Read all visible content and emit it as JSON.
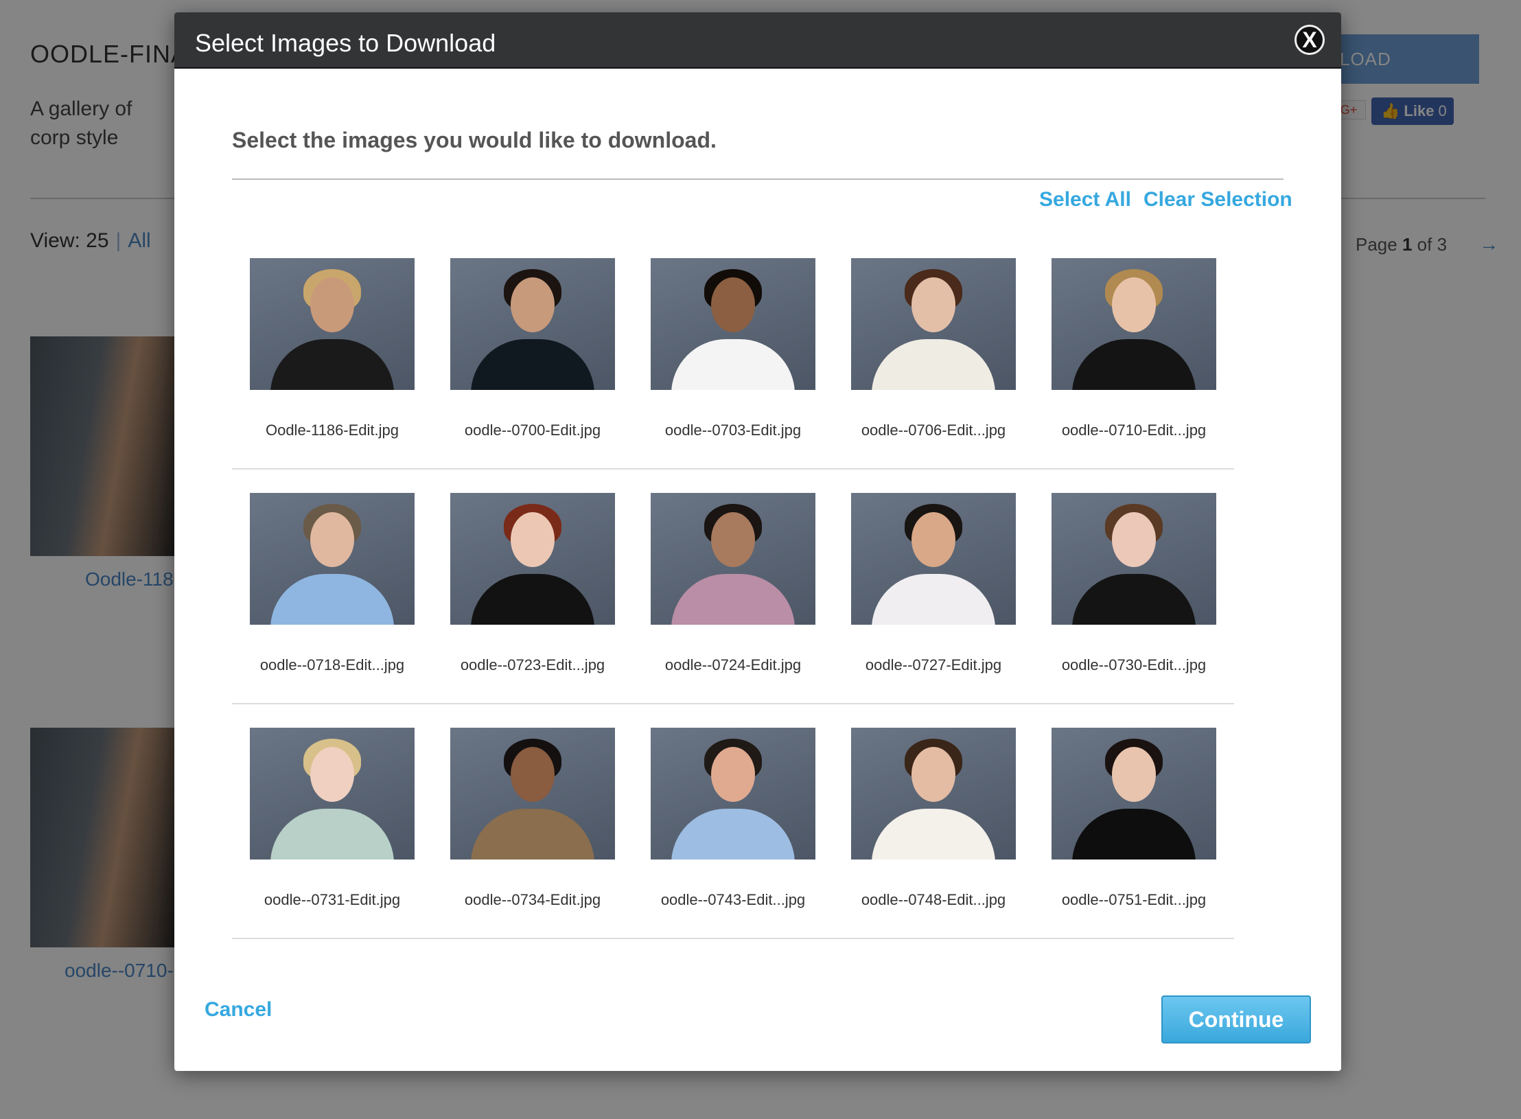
{
  "background": {
    "title": "OODLE-FINA",
    "description": "A gallery of corp style",
    "download_label": "LOAD",
    "gplus_label": "G+",
    "like_label": "Like",
    "like_count": "0",
    "view_label": "View: 25",
    "view_separator": "|",
    "view_all": "All",
    "pager": {
      "prefix": "Page",
      "current": "1",
      "middle": "of 3",
      "next_icon": "arrow-right-icon"
    },
    "captions": [
      "Oodle-118",
      "oodle--0710-"
    ]
  },
  "modal": {
    "title": "Select Images to Download",
    "close_label": "X",
    "instructions": "Select the images you would like to download.",
    "select_all": "Select All",
    "clear_selection": "Clear Selection",
    "cancel": "Cancel",
    "continue": "Continue",
    "accent_color": "#35a8df",
    "header_color": "#333436",
    "rows": [
      [
        {
          "file": "Oodle-1186-Edit.jpg",
          "hair": "#c9a66b",
          "skin": "#c99a7a",
          "clothing": "#1a1a1a"
        },
        {
          "file": "oodle--0700-Edit.jpg",
          "hair": "#1c1410",
          "skin": "#c79a7c",
          "clothing": "#101820"
        },
        {
          "file": "oodle--0703-Edit.jpg",
          "hair": "#120c08",
          "skin": "#8c5f42",
          "clothing": "#f4f4f4"
        },
        {
          "file": "oodle--0706-Edit...jpg",
          "hair": "#4a2a1a",
          "skin": "#e3bfa8",
          "clothing": "#efece4"
        },
        {
          "file": "oodle--0710-Edit...jpg",
          "hair": "#b08a50",
          "skin": "#e8c2a8",
          "clothing": "#141414"
        }
      ],
      [
        {
          "file": "oodle--0718-Edit...jpg",
          "hair": "#6a5a48",
          "skin": "#e0b8a0",
          "clothing": "#8fb6e0"
        },
        {
          "file": "oodle--0723-Edit...jpg",
          "hair": "#7a2a18",
          "skin": "#ecc8b4",
          "clothing": "#121212"
        },
        {
          "file": "oodle--0724-Edit.jpg",
          "hair": "#1a1412",
          "skin": "#a87a5e",
          "clothing": "#b98ea6"
        },
        {
          "file": "oodle--0727-Edit.jpg",
          "hair": "#181412",
          "skin": "#d8a888",
          "clothing": "#f0eef0"
        },
        {
          "file": "oodle--0730-Edit...jpg",
          "hair": "#5a3a24",
          "skin": "#ecc8b8",
          "clothing": "#141414"
        }
      ],
      [
        {
          "file": "oodle--0731-Edit.jpg",
          "hair": "#d8c08a",
          "skin": "#f0d0c0",
          "clothing": "#b8d0c8"
        },
        {
          "file": "oodle--0734-Edit.jpg",
          "hair": "#141010",
          "skin": "#8a5c40",
          "clothing": "#8a6e4e"
        },
        {
          "file": "oodle--0743-Edit...jpg",
          "hair": "#201a16",
          "skin": "#e0aa90",
          "clothing": "#9dbde2"
        },
        {
          "file": "oodle--0748-Edit...jpg",
          "hair": "#3a2618",
          "skin": "#e4bca4",
          "clothing": "#f4f0ea"
        },
        {
          "file": "oodle--0751-Edit...jpg",
          "hair": "#1a1210",
          "skin": "#e8c4ae",
          "clothing": "#0e0e0e"
        }
      ]
    ]
  }
}
